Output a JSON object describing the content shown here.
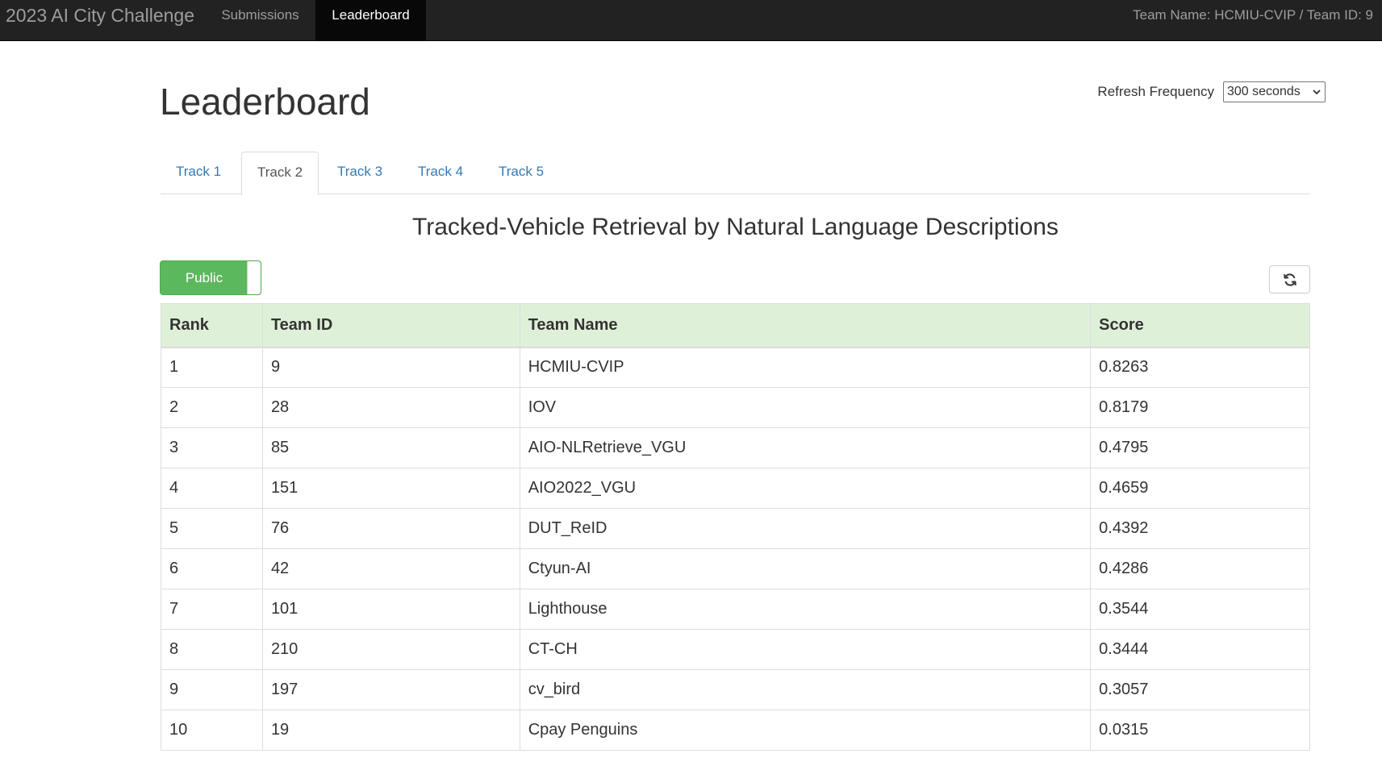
{
  "navbar": {
    "brand": "2023 AI City Challenge",
    "links": [
      {
        "label": "Submissions",
        "active": false
      },
      {
        "label": "Leaderboard",
        "active": true
      }
    ],
    "team_info": "Team Name: HCMIU-CVIP / Team ID: 9"
  },
  "page": {
    "title": "Leaderboard",
    "refresh_label": "Refresh Frequency",
    "refresh_value": "300 seconds"
  },
  "tabs": [
    {
      "label": "Track 1",
      "active": false
    },
    {
      "label": "Track 2",
      "active": true
    },
    {
      "label": "Track 3",
      "active": false
    },
    {
      "label": "Track 4",
      "active": false
    },
    {
      "label": "Track 5",
      "active": false
    }
  ],
  "section_title": "Tracked-Vehicle Retrieval by Natural Language Descriptions",
  "toggle": {
    "label": "Public",
    "on": true
  },
  "refresh_button_icon": "refresh-icon",
  "colors": {
    "navbar_bg": "#222222",
    "header_row_bg": "#dff0d8",
    "toggle_green": "#5cb85c",
    "tab_link": "#337ab7"
  },
  "table": {
    "columns": [
      "Rank",
      "Team ID",
      "Team Name",
      "Score"
    ],
    "rows": [
      [
        "1",
        "9",
        "HCMIU-CVIP",
        "0.8263"
      ],
      [
        "2",
        "28",
        "IOV",
        "0.8179"
      ],
      [
        "3",
        "85",
        "AIO-NLRetrieve_VGU",
        "0.4795"
      ],
      [
        "4",
        "151",
        "AIO2022_VGU",
        "0.4659"
      ],
      [
        "5",
        "76",
        "DUT_ReID",
        "0.4392"
      ],
      [
        "6",
        "42",
        "Ctyun-AI",
        "0.4286"
      ],
      [
        "7",
        "101",
        "Lighthouse",
        "0.3544"
      ],
      [
        "8",
        "210",
        "CT-CH",
        "0.3444"
      ],
      [
        "9",
        "197",
        "cv_bird",
        "0.3057"
      ],
      [
        "10",
        "19",
        "Cpay Penguins",
        "0.0315"
      ]
    ]
  }
}
